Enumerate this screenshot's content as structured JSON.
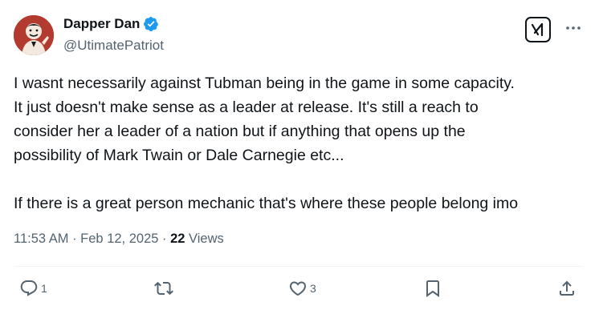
{
  "user": {
    "display_name": "Dapper Dan",
    "handle": "@UtimatePatriot",
    "verified_icon": "verified-badge-icon"
  },
  "header_buttons": {
    "grok_icon": "grok-icon",
    "more_icon": "more-options-icon"
  },
  "tweet": {
    "lines_para1": [
      "I wasnt necessarily against Tubman being in the game in some capacity.",
      "It just doesn't make sense as a leader at release. It's still a reach to",
      "consider her a leader of a nation but if anything that opens up the",
      "possibility of Mark Twain or Dale Carnegie etc..."
    ],
    "para2": "If there is a great person mechanic that's where these people belong imo"
  },
  "meta": {
    "time": "11:53 AM",
    "separator1": " · ",
    "date": "Feb 12, 2025",
    "separator2": " · ",
    "views_count": "22",
    "views_label": " Views"
  },
  "actions": {
    "reply": {
      "icon": "reply-icon",
      "count": "1"
    },
    "repost": {
      "icon": "repost-icon",
      "count": ""
    },
    "like": {
      "icon": "like-icon",
      "count": "3"
    },
    "bookmark": {
      "icon": "bookmark-icon",
      "count": ""
    },
    "share": {
      "icon": "share-icon",
      "count": ""
    }
  },
  "colors": {
    "text_primary": "#0f1419",
    "text_secondary": "#536471",
    "verified_blue": "#1d9bf0",
    "avatar_bg": "#b33a2f",
    "divider": "#eff3f4"
  }
}
